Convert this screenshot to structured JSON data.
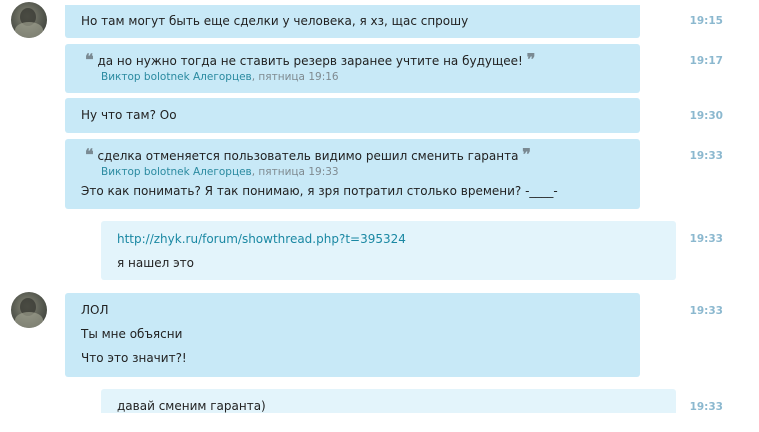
{
  "messages": [
    {
      "text": "Но там могут быть еще сделки у человека, я хз, щас спрошу",
      "time": "19:15"
    },
    {
      "quote": "да но нужно тогда не ставить резерв заранее учтите на будущее!",
      "author": "Виктор bolotnek Алегорцев",
      "meta": ", пятница 19:16",
      "time": "19:17"
    },
    {
      "text": "Ну что там? Оо",
      "time": "19:30"
    },
    {
      "quote": "сделка отменяется пользователь видимо решил сменить гаранта",
      "author": "Виктор bolotnek Алегорцев",
      "meta": ", пятница 19:33",
      "text": "Это как понимать? Я так понимаю, я зря потратил столько времени? -____-",
      "time": "19:33"
    },
    {
      "link": "http://zhyk.ru/forum/showthread.php?t=395324",
      "text": "я нашел это",
      "time": "19:33"
    },
    {
      "lines": [
        "ЛОЛ",
        "Ты мне объясни",
        "Что это значит?!"
      ],
      "time": "19:33"
    },
    {
      "text": "давай сменим гаранта)",
      "time": "19:33"
    }
  ]
}
